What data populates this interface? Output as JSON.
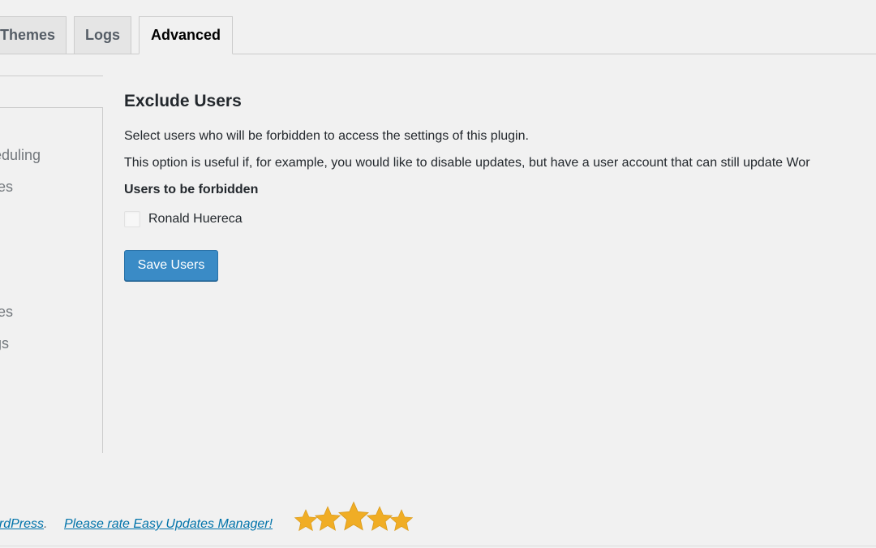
{
  "tabs": [
    {
      "label": "Themes",
      "active": false
    },
    {
      "label": "Logs",
      "active": false
    },
    {
      "label": "Advanced",
      "active": true
    }
  ],
  "sidebar": {
    "items": [
      {
        "label": "eduling"
      },
      {
        "label": "tes"
      },
      {
        "label": "tes"
      },
      {
        "label": "gs"
      }
    ]
  },
  "main": {
    "title": "Exclude Users",
    "description_1": "Select users who will be forbidden to access the settings of this plugin.",
    "description_2": "This option is useful if, for example, you would like to disable updates, but have a user account that can still update Wor",
    "users_heading": "Users to be forbidden",
    "users": [
      {
        "name": "Ronald Huereca",
        "checked": false
      }
    ],
    "save_label": "Save Users"
  },
  "footer": {
    "prefix_text": "ordPress",
    "separator": ".",
    "rate_link": "Please rate Easy Updates Manager!",
    "stars": 5,
    "star_color": "#f0ad25"
  },
  "colors": {
    "accent": "#3a8bc6",
    "link": "#0073aa",
    "background": "#f1f1f1"
  }
}
